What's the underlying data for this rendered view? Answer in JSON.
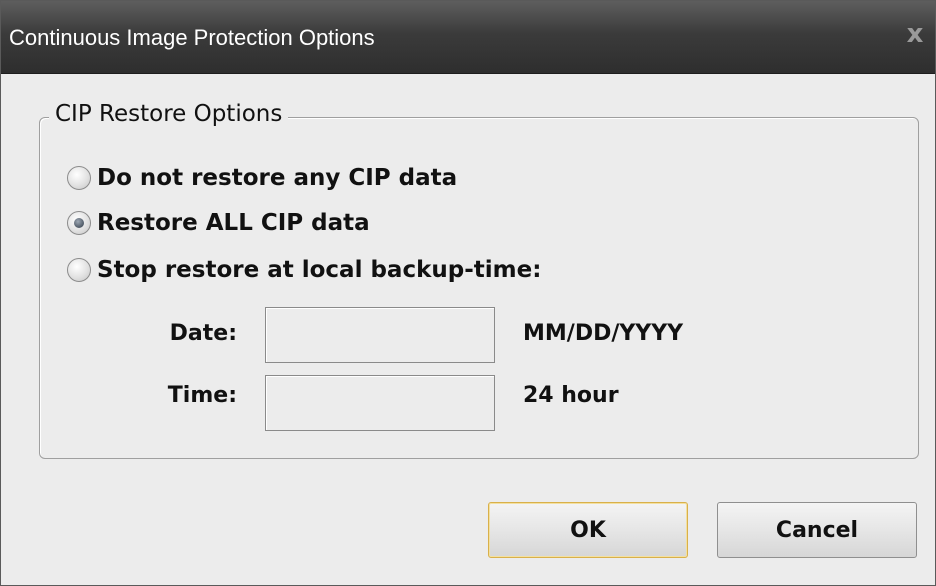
{
  "window": {
    "title": "Continuous Image Protection Options",
    "close_glyph": "x"
  },
  "group": {
    "legend": "CIP Restore Options",
    "options": [
      {
        "label": "Do not restore any CIP data",
        "checked": false
      },
      {
        "label": "Restore ALL CIP data",
        "checked": true
      },
      {
        "label": "Stop restore at local backup-time:",
        "checked": false
      }
    ],
    "date": {
      "label": "Date:",
      "value": "",
      "hint": "MM/DD/YYYY"
    },
    "time": {
      "label": "Time:",
      "value": "",
      "hint": "24 hour"
    }
  },
  "buttons": {
    "ok": "OK",
    "cancel": "Cancel"
  },
  "icons": {
    "radio": "radio-icon",
    "close": "close-icon"
  }
}
